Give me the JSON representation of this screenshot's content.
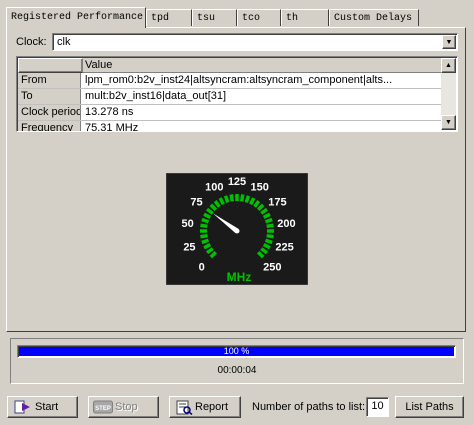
{
  "tabs": [
    {
      "label": "Registered Performance",
      "active": true
    },
    {
      "label": "tpd"
    },
    {
      "label": "tsu"
    },
    {
      "label": "tco"
    },
    {
      "label": "th"
    },
    {
      "label": "Custom Delays"
    }
  ],
  "clock": {
    "label": "Clock:",
    "value": "clk"
  },
  "grid": {
    "column_header": "Value",
    "rows": [
      {
        "name": "From",
        "value": "lpm_rom0:b2v_inst24|altsyncram:altsyncram_component|alts..."
      },
      {
        "name": "To",
        "value": "mult:b2v_inst16|data_out[31]"
      },
      {
        "name": "Clock period",
        "value": "13.278 ns"
      },
      {
        "name": "Frequency",
        "value": "75.31 MHz"
      }
    ]
  },
  "gauge": {
    "unit": "MHz",
    "value": 75.31,
    "min": 0,
    "max": 250,
    "tick_labels": [
      "0",
      "25",
      "50",
      "75",
      "100",
      "125",
      "150",
      "175",
      "200",
      "225",
      "250"
    ],
    "colors": {
      "face": "#1a1a1a",
      "ticks": "#00c000",
      "labels": "#ffffff",
      "needle": "#ffffff",
      "unit": "#00c000"
    }
  },
  "progress": {
    "percent": 100,
    "text": "100 %",
    "elapsed": "00:00:04",
    "color": "#0000ff"
  },
  "buttons": {
    "start": "Start",
    "stop": "Stop",
    "stop_icon_text": "STEP",
    "report": "Report",
    "list_paths": "List Paths"
  },
  "paths": {
    "label": "Number of paths to list:",
    "value": "10"
  },
  "icons": {
    "dropdown": "chevron-down-icon",
    "start": "play-icon",
    "stop": "stop-icon",
    "report": "report-icon"
  }
}
